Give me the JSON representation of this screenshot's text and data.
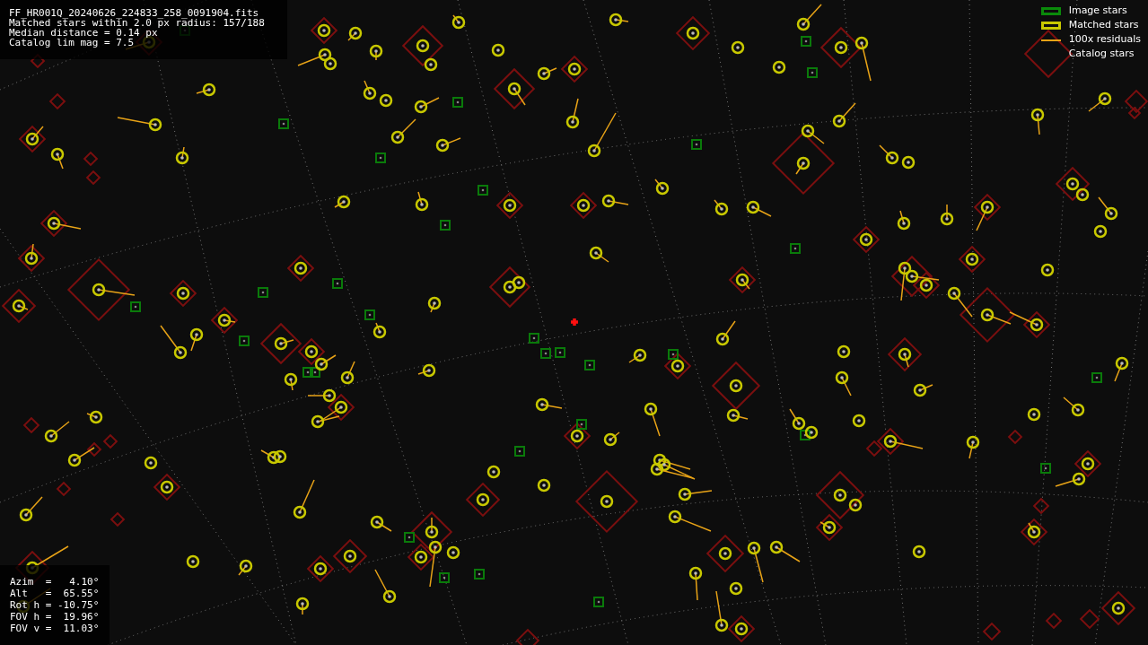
{
  "info_lines": [
    "FF_HR001Q_20240626_224833_258_0091904.fits",
    "Matched stars within 2.0 px radius: 157/188",
    "Median distance = 0.14 px",
    "Catalog lim mag = 7.5"
  ],
  "legend": [
    {
      "kind": "image",
      "label": "Image stars"
    },
    {
      "kind": "matched",
      "label": "Matched stars"
    },
    {
      "kind": "residual",
      "label": "100x residuals"
    },
    {
      "kind": "catalog",
      "label": "Catalog stars"
    }
  ],
  "pointing": [
    "Azim  =   4.10°",
    "Alt   =  65.55°",
    "Rot h = -10.75°",
    "FOV h =  19.96°",
    "FOV v =  11.03°"
  ]
}
